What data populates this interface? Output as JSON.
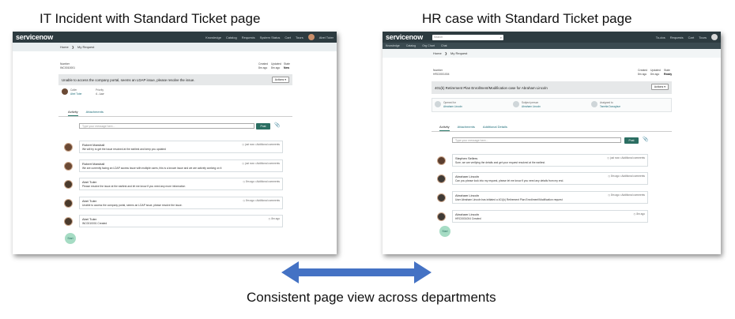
{
  "captions": {
    "left": "IT Incident with Standard Ticket page",
    "right": "HR case with Standard Ticket page",
    "bottom": "Consistent page view across departments"
  },
  "colors": {
    "topbar": "#2d3b40",
    "accent": "#2b6e62",
    "arrow": "#4472c4"
  },
  "left_screen": {
    "logo": "servicenow",
    "nav": [
      "Knowledge",
      "Catalog",
      "Requests",
      "System Status",
      "Cart",
      "Tours",
      "Abel Tuter"
    ],
    "breadcrumb": [
      "Home",
      "My Request"
    ],
    "meta": {
      "number_label": "Number",
      "number": "INC0010001",
      "created_label": "Created",
      "created": "8m ago",
      "updated_label": "Updated",
      "updated": "8m ago",
      "state_label": "State",
      "state": "New"
    },
    "subject": "Unable to access the company portal, seems an LDAP issue, please resolve the issue.",
    "actions_label": "Actions",
    "fields": {
      "caller_label": "Caller",
      "caller": "Abel Tuter",
      "priority_label": "Priority",
      "priority": "4 - Low"
    },
    "tabs": [
      "Activity",
      "Attachments"
    ],
    "message_placeholder": "Type your message here...",
    "post_label": "Post",
    "entries": [
      {
        "name": "Robert Marshall",
        "when": "just now",
        "tag": "Additional comments",
        "body": "We will try to get the issue resolved at the earliest and keep you updated"
      },
      {
        "name": "Robert Marshall",
        "when": "just now",
        "tag": "Additional comments",
        "body": "We are currently facing an LDAP access issue with multiple users, this is a known issue and we are actively working on it"
      },
      {
        "name": "Abel Tuter",
        "when": "8m ago",
        "tag": "Additional comments",
        "body": "Please resolve the issue at the earliest and let me know if you need any more information"
      },
      {
        "name": "Abel Tuter",
        "when": "8m ago",
        "tag": "Additional comments",
        "body": "Unable to access the company portal, seems an LDAP issue, please resolve the issue."
      },
      {
        "name": "Abel Tuter",
        "when": "8m ago",
        "tag": "",
        "body": "INC0010001 Created"
      }
    ],
    "start_label": "Start"
  },
  "right_screen": {
    "logo": "servicenow",
    "search_placeholder": "Search",
    "nav": [
      "To-dos",
      "Requests",
      "Cart",
      "Tours"
    ],
    "subnav": [
      "Knowledge",
      "Catalog",
      "Org Chart",
      "Chat"
    ],
    "breadcrumb": [
      "Home",
      "My Request"
    ],
    "meta": {
      "number_label": "Number",
      "number": "HRC0001004",
      "created_label": "Created",
      "created": "8m ago",
      "updated_label": "Updated",
      "updated": "8m ago",
      "state_label": "State",
      "state": "Ready"
    },
    "subject": "401(k) Retirement Plan Enrollment/Modification case for Abraham Lincoln",
    "actions_label": "Actions",
    "people": [
      {
        "label": "Opened for",
        "value": "Abraham Lincoln"
      },
      {
        "label": "Subject person",
        "value": "Abraham Lincoln"
      },
      {
        "label": "Assigned to",
        "value": "Tanetta Donaghue"
      }
    ],
    "tabs": [
      "Activity",
      "Attachments",
      "Additional Details"
    ],
    "message_placeholder": "Type your message here...",
    "post_label": "Post",
    "entries": [
      {
        "name": "Stephen Sellers",
        "when": "just now",
        "tag": "Additional comments",
        "body": "Sure, we are verifying the details and get your request resolved at the earliest."
      },
      {
        "name": "Abraham Lincoln",
        "when": "8m ago",
        "tag": "Additional comments",
        "body": "Can you please look into my request, please let me know if you need any details from my end."
      },
      {
        "name": "Abraham Lincoln",
        "when": "8m ago",
        "tag": "Additional comments",
        "body": "User Abraham Lincoln has initiated a 401(k) Retirement Plan Enrollment/Modification request"
      },
      {
        "name": "Abraham Lincoln",
        "when": "8m ago",
        "tag": "",
        "body": "HRC0001004 Created"
      }
    ],
    "start_label": "Start"
  }
}
